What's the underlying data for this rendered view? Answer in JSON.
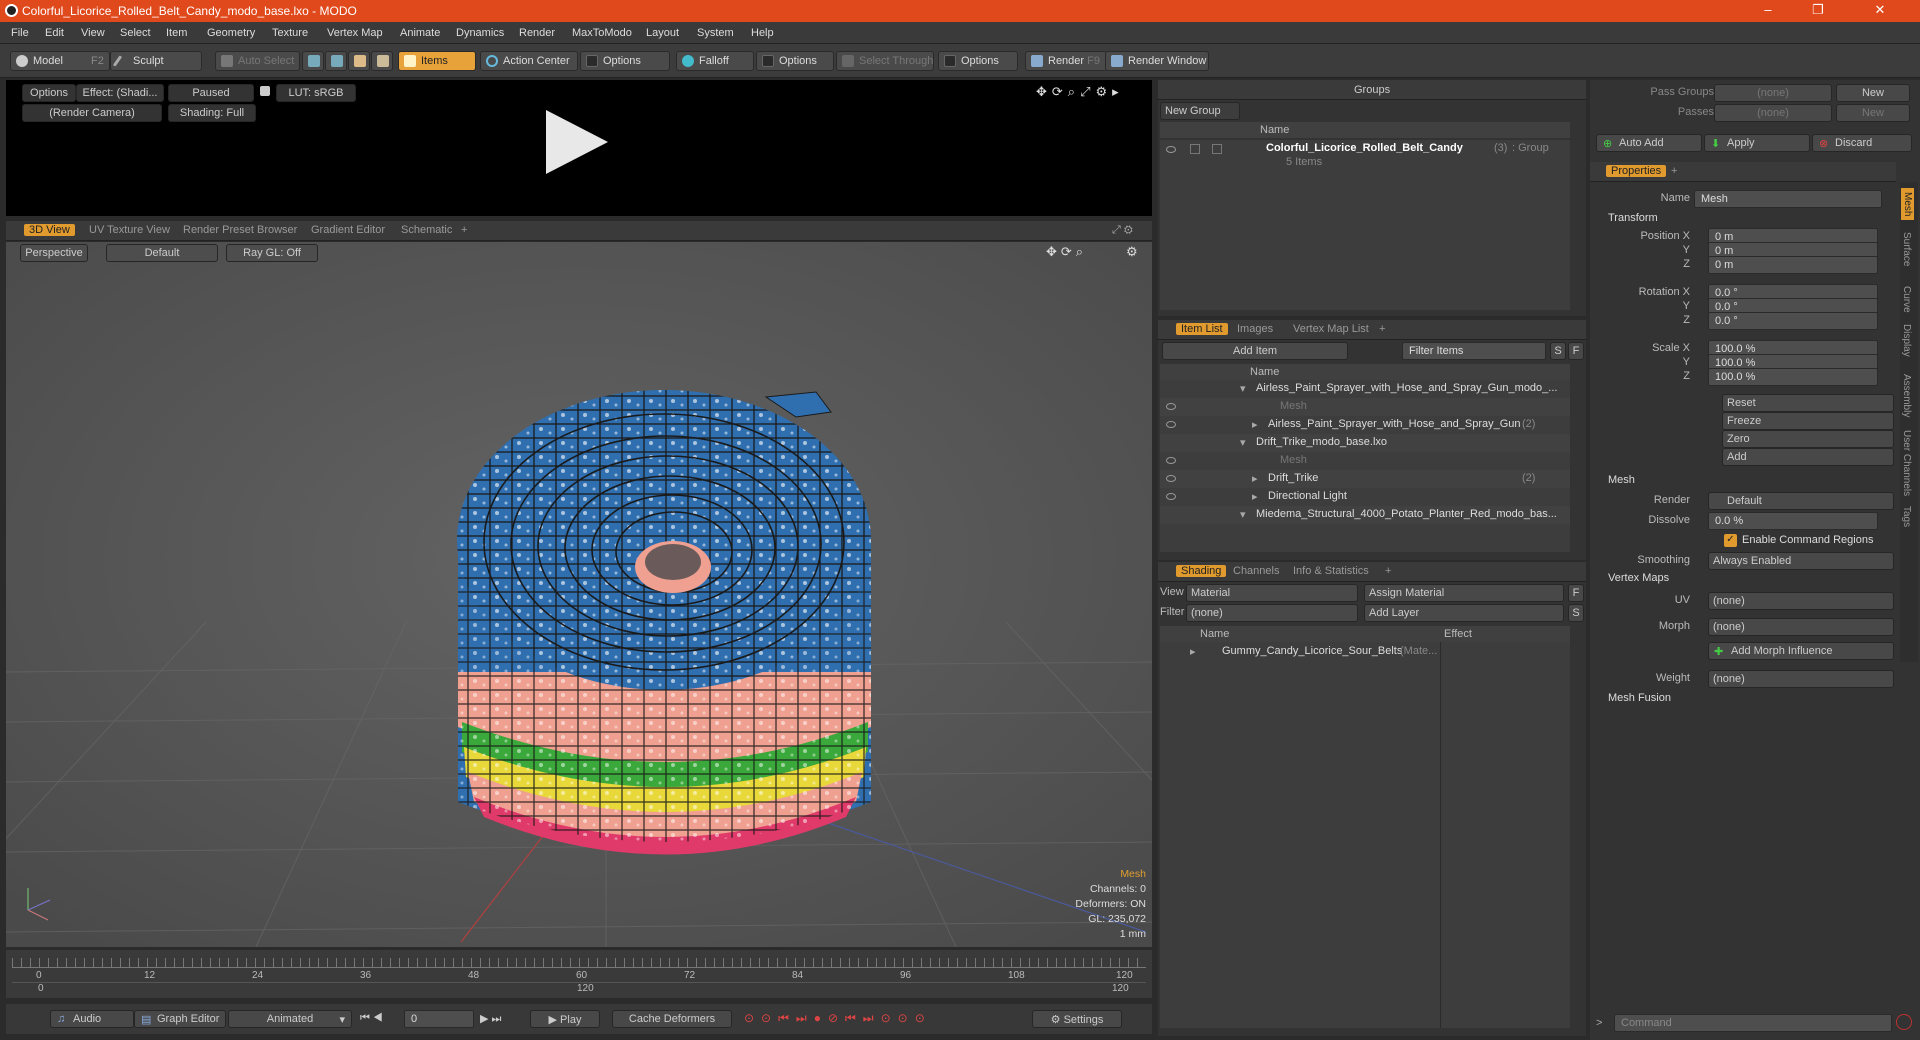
{
  "titlebar": {
    "title": "Colorful_Licorice_Rolled_Belt_Candy_modo_base.lxo - MODO",
    "min": "–",
    "max": "❐",
    "close": "✕"
  },
  "menu": [
    "File",
    "Edit",
    "View",
    "Select",
    "Item",
    "Geometry",
    "Texture",
    "Vertex Map",
    "Animate",
    "Dynamics",
    "Render",
    "MaxToModo",
    "Layout",
    "System",
    "Help"
  ],
  "toolbar": {
    "model": "Model",
    "model_key": "F2",
    "sculpt": "Sculpt",
    "auto_select": "Auto Select",
    "items": "Items",
    "action_center": "Action Center",
    "options1": "Options",
    "falloff": "Falloff",
    "options2": "Options",
    "select_through": "Select Through",
    "options3": "Options",
    "render": "Render",
    "render_key": "F9",
    "render_window": "Render Window"
  },
  "preview": {
    "options": "Options",
    "effect": "Effect: (Shadi...",
    "paused": "Paused",
    "lut": "LUT: sRGB",
    "camera": "(Render Camera)",
    "shading": "Shading: Full"
  },
  "view_tabs": [
    "3D View",
    "UV Texture View",
    "Render Preset Browser",
    "Gradient Editor",
    "Schematic",
    "+"
  ],
  "viewport": {
    "perspective": "Perspective",
    "default": "Default",
    "raygl": "Ray GL: Off",
    "info": {
      "mesh": "Mesh",
      "channels": "Channels: 0",
      "deformers": "Deformers: ON",
      "gl": "GL: 235,072",
      "unit": "1 mm"
    }
  },
  "timeline": {
    "ticks": [
      "0",
      "12",
      "24",
      "36",
      "48",
      "60",
      "72",
      "84",
      "96",
      "108",
      "120"
    ],
    "sub": [
      "0",
      "120",
      "120"
    ]
  },
  "bottombar": {
    "audio": "Audio",
    "graph_editor": "Graph Editor",
    "animated": "Animated",
    "frame": "0",
    "play": "Play",
    "cache": "Cache Deformers",
    "settings": "Settings"
  },
  "groups": {
    "title": "Groups",
    "new_group": "New Group",
    "col_name": "Name",
    "item_name": "Colorful_Licorice_Rolled_Belt_Candy",
    "item_count": "(3)",
    "item_type": ": Group",
    "item_sub": "5 Items"
  },
  "itemlist": {
    "tabs": [
      "Item List",
      "Images",
      "Vertex Map List",
      "+"
    ],
    "add_item": "Add Item",
    "filter": "Filter Items",
    "s": "S",
    "f": "F",
    "col_name": "Name",
    "rows": [
      {
        "text": "Airless_Paint_Sprayer_with_Hose_and_Spray_Gun_modo_...",
        "indent": 0,
        "dim": false
      },
      {
        "text": "Mesh",
        "indent": 2,
        "dim": true
      },
      {
        "text": "Airless_Paint_Sprayer_with_Hose_and_Spray_Gun",
        "extra": "(2)",
        "indent": 1,
        "dim": false
      },
      {
        "text": "Drift_Trike_modo_base.lxo",
        "indent": 0,
        "dim": false
      },
      {
        "text": "Mesh",
        "indent": 2,
        "dim": true
      },
      {
        "text": "Drift_Trike",
        "extra": "(2)",
        "indent": 1,
        "dim": false
      },
      {
        "text": "Directional Light",
        "indent": 1,
        "dim": false
      },
      {
        "text": "Miedema_Structural_4000_Potato_Planter_Red_modo_bas...",
        "indent": 0,
        "dim": false
      }
    ]
  },
  "shading": {
    "tabs": [
      "Shading",
      "Channels",
      "Info & Statistics",
      "+"
    ],
    "view_lbl": "View",
    "view_val": "Material",
    "assign": "Assign Material",
    "f": "F",
    "filter_lbl": "Filter",
    "filter_val": "(none)",
    "add_layer": "Add Layer",
    "s": "S",
    "col_name": "Name",
    "col_effect": "Effect",
    "item": "Gummy_Candy_Licorice_Sour_Belts",
    "item_type": "(Mate..."
  },
  "right": {
    "pass_groups": "Pass Groups",
    "passes": "Passes",
    "none": "(none)",
    "new": "New",
    "auto_add": "Auto Add",
    "apply": "Apply",
    "discard": "Discard",
    "props_tab": "Properties",
    "plus": "+",
    "name_lbl": "Name",
    "name_val": "Mesh",
    "transform": "Transform",
    "pos": {
      "lbl": "Position X",
      "y": "Y",
      "z": "Z",
      "vals": [
        "0 m",
        "0 m",
        "0 m"
      ]
    },
    "rot": {
      "lbl": "Rotation X",
      "vals": [
        "0.0 °",
        "0.0 °",
        "0.0 °"
      ]
    },
    "scl": {
      "lbl": "Scale X",
      "vals": [
        "100.0 %",
        "100.0 %",
        "100.0 %"
      ]
    },
    "reset": "Reset",
    "freeze": "Freeze",
    "zero": "Zero",
    "add": "Add",
    "mesh": "Mesh",
    "render_lbl": "Render",
    "render_val": "Default",
    "dissolve_lbl": "Dissolve",
    "dissolve_val": "0.0 %",
    "enable_cmd": "Enable Command Regions",
    "smoothing_lbl": "Smoothing",
    "smoothing_val": "Always Enabled",
    "vertex_maps": "Vertex Maps",
    "uv_lbl": "UV",
    "morph_lbl": "Morph",
    "add_morph": "Add Morph Influence",
    "weight_lbl": "Weight",
    "mesh_fusion": "Mesh Fusion",
    "side_tabs": [
      "Mesh",
      "Surface",
      "Curve",
      "Display",
      "Assembly",
      "User Channels",
      "Tags"
    ],
    "command": "Command"
  },
  "colors": {
    "accent": "#e09a2e",
    "title": "#e0491c",
    "blue": "#2f6fb0",
    "pink": "#f0a090",
    "green": "#3aa83a",
    "yellow": "#e8d83a",
    "magenta": "#e03a6a"
  }
}
